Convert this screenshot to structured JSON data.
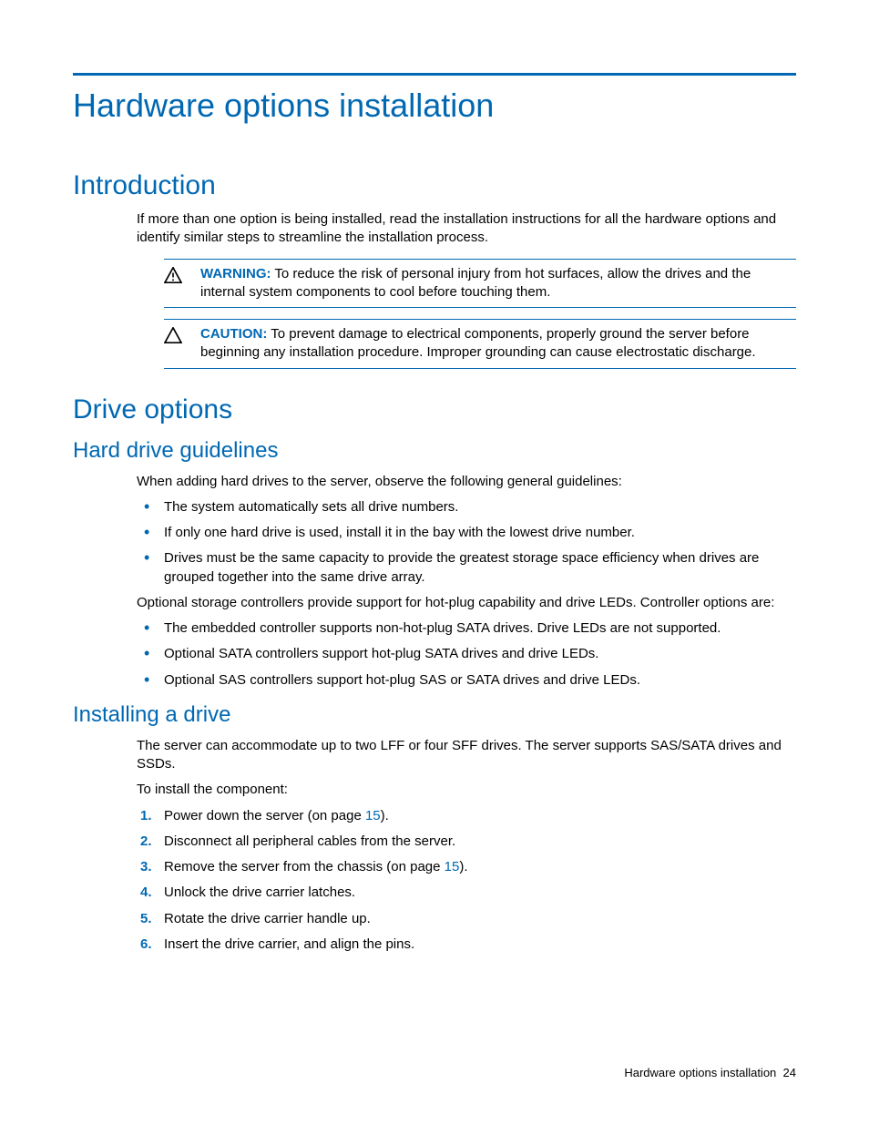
{
  "title": "Hardware options installation",
  "sections": {
    "intro": {
      "heading": "Introduction",
      "para": "If more than one option is being installed, read the installation instructions for all the hardware options and identify similar steps to streamline the installation process."
    },
    "warning": {
      "label": "WARNING:",
      "text": "To reduce the risk of personal injury from hot surfaces, allow the drives and the internal system components to cool before touching them."
    },
    "caution": {
      "label": "CAUTION:",
      "text": "To prevent damage to electrical components, properly ground the server before beginning any installation procedure. Improper grounding can cause electrostatic discharge."
    },
    "drive_options": {
      "heading": "Drive options"
    },
    "guidelines": {
      "heading": "Hard drive guidelines",
      "intro": "When adding hard drives to the server, observe the following general guidelines:",
      "bullets1": [
        "The system automatically sets all drive numbers.",
        "If only one hard drive is used, install it in the bay with the lowest drive number.",
        "Drives must be the same capacity to provide the greatest storage space efficiency when drives are grouped together into the same drive array."
      ],
      "para2": "Optional storage controllers provide support for hot-plug capability and drive LEDs. Controller options are:",
      "bullets2": [
        "The embedded controller supports non-hot-plug SATA drives. Drive LEDs are not supported.",
        "Optional SATA controllers support hot-plug SATA drives and drive LEDs.",
        "Optional SAS controllers support hot-plug SAS or SATA drives and drive LEDs."
      ]
    },
    "installing": {
      "heading": "Installing a drive",
      "para1": "The server can accommodate up to two LFF or four SFF drives. The server supports SAS/SATA drives and SSDs.",
      "para2": "To install the component:",
      "steps": [
        {
          "pre": "Power down the server (on page ",
          "link": "15",
          "post": ")."
        },
        {
          "pre": "Disconnect all peripheral cables from the server.",
          "link": "",
          "post": ""
        },
        {
          "pre": "Remove the server from the chassis (on page ",
          "link": "15",
          "post": ")."
        },
        {
          "pre": "Unlock the drive carrier latches.",
          "link": "",
          "post": ""
        },
        {
          "pre": "Rotate the drive carrier handle up.",
          "link": "",
          "post": ""
        },
        {
          "pre": "Insert the drive carrier, and align the pins.",
          "link": "",
          "post": ""
        }
      ]
    }
  },
  "footer": {
    "title": "Hardware options installation",
    "page": "24"
  }
}
